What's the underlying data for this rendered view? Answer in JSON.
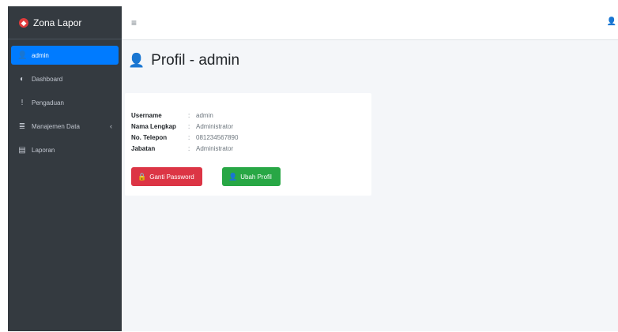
{
  "app": {
    "brand": "Zona Lapor"
  },
  "sidebar": {
    "items": [
      {
        "label": "admin",
        "icon": "user-icon"
      },
      {
        "label": "Dashboard",
        "icon": "dashboard-icon"
      },
      {
        "label": "Pengaduan",
        "icon": "exclamation-icon"
      },
      {
        "label": "Manajemen Data",
        "icon": "database-icon"
      },
      {
        "label": "Laporan",
        "icon": "file-icon"
      }
    ]
  },
  "topbar": {
    "menu_icon": "hamburger-icon",
    "user_icon": "user-icon"
  },
  "page": {
    "title": "Profil - admin"
  },
  "profile": {
    "rows": [
      {
        "key": "Username",
        "value": "admin"
      },
      {
        "key": "Nama Lengkap",
        "value": "Administrator"
      },
      {
        "key": "No. Telepon",
        "value": "081234567890"
      },
      {
        "key": "Jabatan",
        "value": "Administrator"
      }
    ],
    "change_password_label": "Ganti Password",
    "edit_profile_label": "Ubah Profil"
  },
  "colors": {
    "sidebar": "#343a40",
    "active": "#007bff",
    "danger": "#dc3545",
    "success": "#28a745"
  }
}
